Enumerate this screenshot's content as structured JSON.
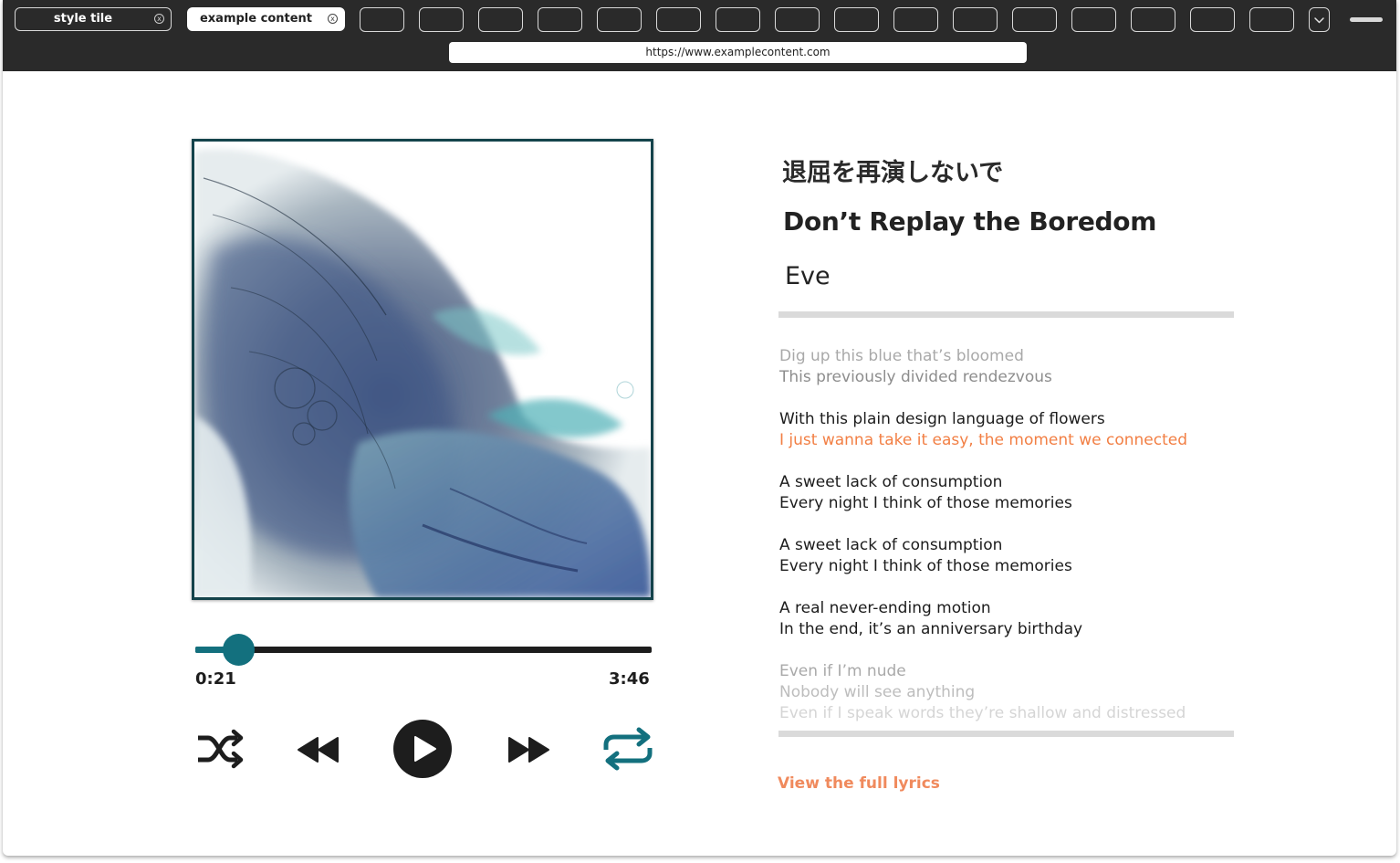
{
  "browser": {
    "tabs": [
      {
        "label": "style tile"
      },
      {
        "label": "example content"
      }
    ],
    "url": "https://www.examplecontent.com",
    "tab_close_glyph": "x"
  },
  "player": {
    "elapsed": "0:21",
    "duration": "3:46",
    "progress_fraction": 0.093,
    "accent_color": "#13707e",
    "controls": [
      "shuffle-icon",
      "rewind-icon",
      "play-icon",
      "fast-forward-icon",
      "repeat-icon"
    ]
  },
  "song": {
    "title_jp": "退屈を再演しないで",
    "title_en": "Don’t Replay the Boredom",
    "artist": "Eve"
  },
  "lyrics": {
    "stanzas": [
      [
        "Dig up this blue that’s bloomed",
        "This previously divided rendezvous"
      ],
      [
        "With this plain design language of flowers",
        "I just wanna take it easy, the moment we connected"
      ],
      [
        "A sweet lack of consumption",
        "Every night I think of those memories"
      ],
      [
        "A sweet lack of consumption",
        "Every night I think of those memories"
      ],
      [
        "A real never-ending motion",
        "In the end, it’s an anniversary birthday"
      ],
      [
        "Even if I’m nude",
        "Nobody will see anything",
        "Even if I speak words they’re shallow and distressed"
      ]
    ],
    "highlight_color": "#f27f44",
    "full_lyrics_link": "View the full lyrics"
  }
}
